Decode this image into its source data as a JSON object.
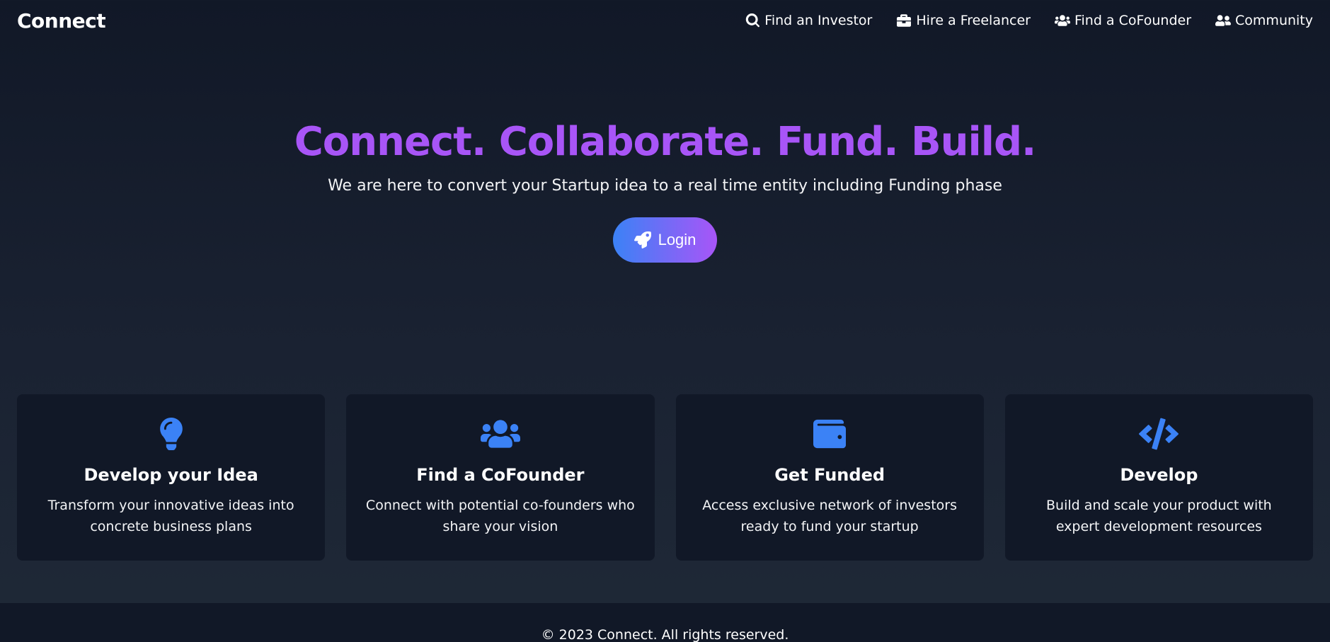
{
  "nav": {
    "brand": "Connect",
    "links": [
      {
        "label": "Find an Investor",
        "icon": "search-icon"
      },
      {
        "label": "Hire a Freelancer",
        "icon": "briefcase-icon"
      },
      {
        "label": "Find a CoFounder",
        "icon": "users-icon"
      },
      {
        "label": "Community",
        "icon": "user-friends-icon"
      }
    ]
  },
  "hero": {
    "title": "Connect. Collaborate. Fund. Build.",
    "subtitle": "We are here to convert your Startup idea to a real time entity including Funding phase",
    "login_label": "Login",
    "login_icon": "rocket-icon"
  },
  "features": [
    {
      "icon": "lightbulb-icon",
      "title": "Develop your Idea",
      "desc": "Transform your innovative ideas into concrete business plans"
    },
    {
      "icon": "users-icon",
      "title": "Find a CoFounder",
      "desc": "Connect with potential co-founders who share your vision"
    },
    {
      "icon": "wallet-icon",
      "title": "Get Funded",
      "desc": "Access exclusive network of investors ready to fund your startup"
    },
    {
      "icon": "code-icon",
      "title": "Develop",
      "desc": "Build and scale your product with expert development resources"
    }
  ],
  "footer": {
    "text": "© 2023 Connect. All rights reserved."
  },
  "colors": {
    "accent_purple": "#a855f7",
    "accent_blue": "#3b82f6",
    "background": "#111827",
    "card_background": "#111827"
  }
}
